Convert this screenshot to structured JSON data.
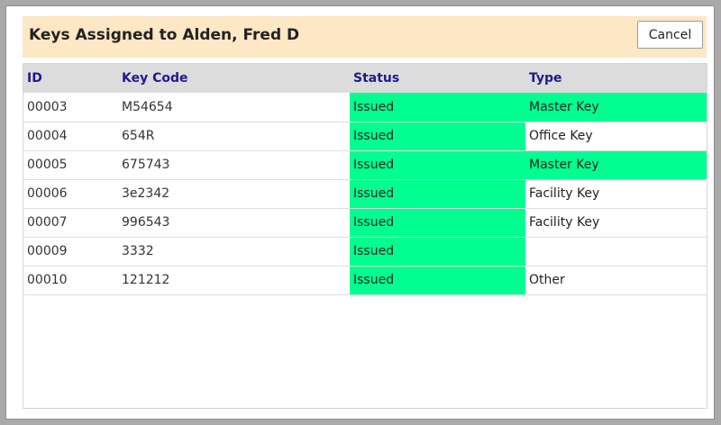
{
  "modal": {
    "title": "Keys Assigned to Alden, Fred D",
    "cancel_label": "Cancel"
  },
  "colors": {
    "header_bg": "#fde7c4",
    "issued_highlight": "#00ff90",
    "column_header_text": "#1f1a8c"
  },
  "grid": {
    "columns": [
      "ID",
      "Key Code",
      "Status",
      "Type"
    ],
    "rows": [
      {
        "id": "00003",
        "key_code": "M54654",
        "status": "Issued",
        "type": "Master Key"
      },
      {
        "id": "00004",
        "key_code": "654R",
        "status": "Issued",
        "type": "Office Key"
      },
      {
        "id": "00005",
        "key_code": "675743",
        "status": "Issued",
        "type": "Master Key"
      },
      {
        "id": "00006",
        "key_code": "3e2342",
        "status": "Issued",
        "type": "Facility Key"
      },
      {
        "id": "00007",
        "key_code": "996543",
        "status": "Issued",
        "type": "Facility Key"
      },
      {
        "id": "00009",
        "key_code": "3332",
        "status": "Issued",
        "type": ""
      },
      {
        "id": "00010",
        "key_code": "121212",
        "status": "Issued",
        "type": "Other"
      }
    ]
  }
}
